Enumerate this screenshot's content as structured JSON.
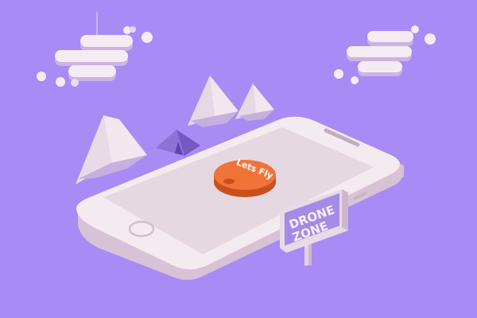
{
  "scene": {
    "background_color": "#a88bf5",
    "phone_color": "#f1e5ec",
    "screen_color": "#e6d8e0",
    "button_color": "#f2733a",
    "sign_color": "#a58be7"
  },
  "button": {
    "label": "Lets Fly"
  },
  "sign": {
    "line1": "DRONE",
    "line2": "ZONE"
  }
}
